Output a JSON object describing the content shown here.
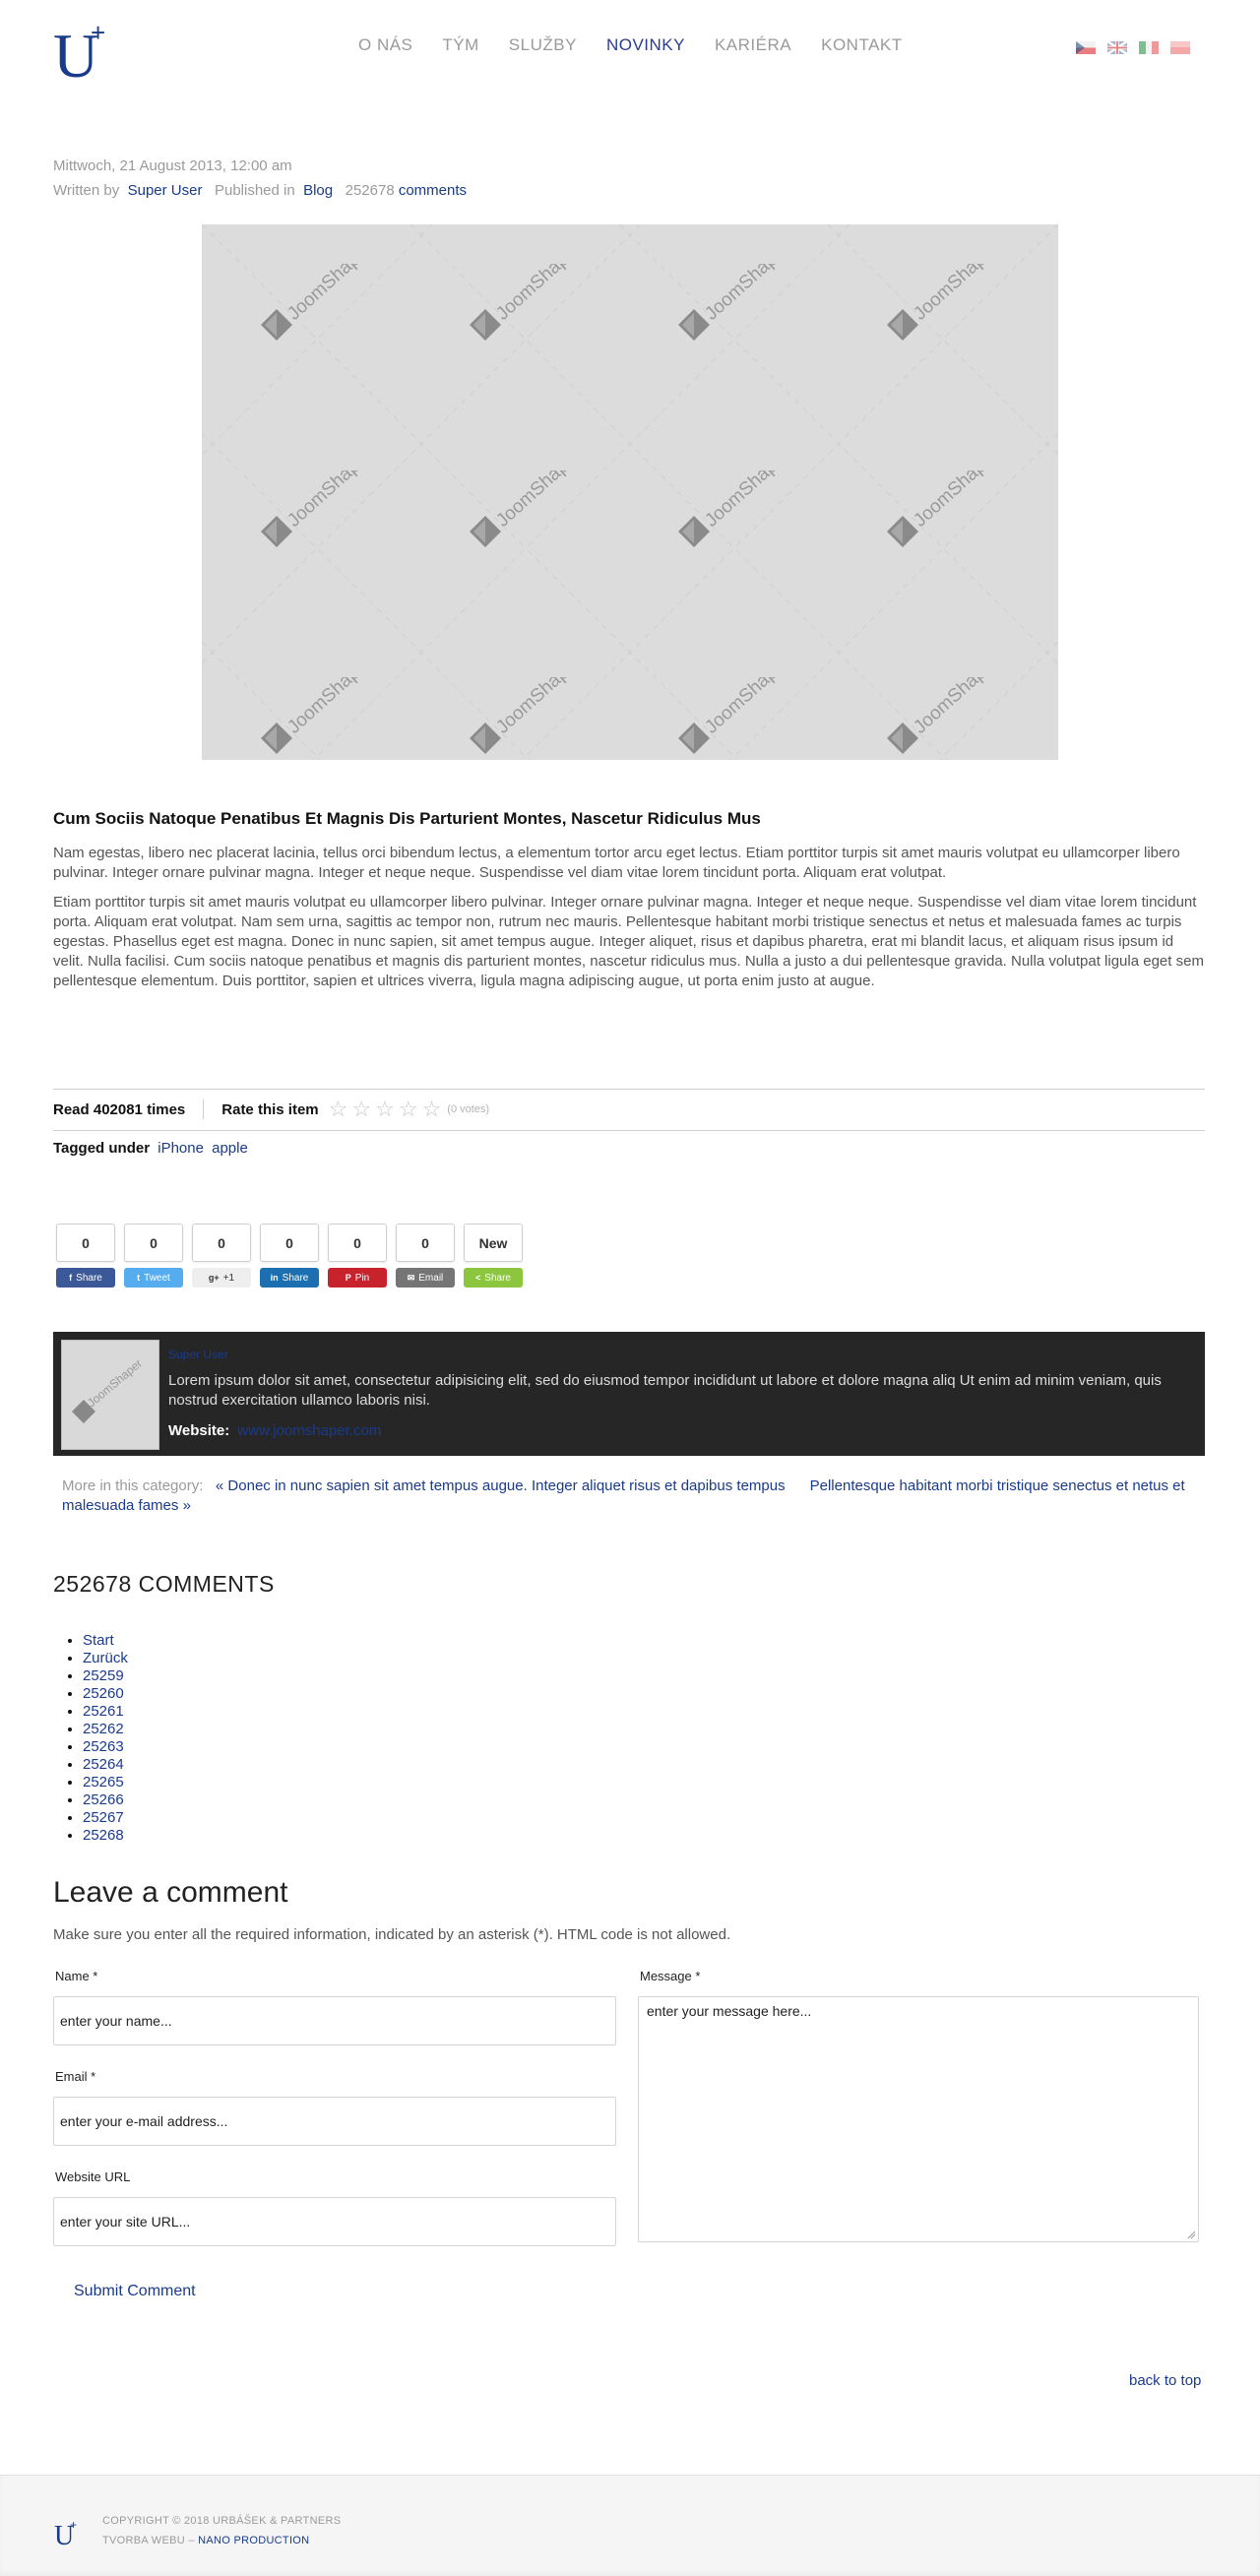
{
  "header": {
    "logo_letter": "U",
    "logo_plus": "+",
    "nav": [
      {
        "label": "O NÁS",
        "active": false
      },
      {
        "label": "TÝM",
        "active": false
      },
      {
        "label": "SLUŽBY",
        "active": false
      },
      {
        "label": "NOVINKY",
        "active": true
      },
      {
        "label": "KARIÉRA",
        "active": false
      },
      {
        "label": "KONTAKT",
        "active": false
      }
    ],
    "flags": [
      "cz-flag-icon",
      "uk-flag-icon",
      "it-flag-icon",
      "pl-flag-icon"
    ]
  },
  "article": {
    "date": "Mittwoch, 21 August 2013, 12:00 am",
    "written_by_label": "Written by",
    "author": "Super User",
    "published_in_label": "Published in",
    "category": "Blog",
    "comment_count": "252678",
    "comments_link": "comments",
    "image_watermark": "JoomShaper",
    "title": "Cum Sociis Natoque Penatibus Et Magnis Dis Parturient Montes, Nascetur Ridiculus Mus",
    "paragraph1": "Nam egestas, libero nec placerat lacinia, tellus orci bibendum lectus, a elementum tortor arcu eget lectus. Etiam porttitor turpis sit amet mauris volutpat eu ullamcorper libero pulvinar. Integer ornare pulvinar magna. Integer et neque neque. Suspendisse vel diam vitae lorem tincidunt porta. Aliquam erat volutpat.",
    "paragraph2": "Etiam porttitor turpis sit amet mauris volutpat eu ullamcorper libero pulvinar. Integer ornare pulvinar magna. Integer et neque neque. Suspendisse vel diam vitae lorem tincidunt porta. Aliquam erat volutpat. Nam sem urna, sagittis ac tempor non, rutrum nec mauris. Pellentesque habitant morbi tristique senectus et netus et malesuada fames ac turpis egestas. Phasellus eget est magna. Donec in nunc sapien, sit amet tempus augue. Integer aliquet, risus et dapibus pharetra, erat mi blandit lacus, et aliquam risus ipsum id velit. Nulla facilisi. Cum sociis natoque penatibus et magnis dis parturient montes, nascetur ridiculus mus. Nulla a justo a dui pellentesque gravida. Nulla volutpat ligula eget sem pellentesque elementum. Duis porttitor, sapien et ultrices viverra, ligula magna adipiscing augue, ut porta enim justo at augue."
  },
  "stats": {
    "read_label": "Read 402081 times",
    "rate_label": "Rate this item",
    "rating": 0,
    "stars_max": 5,
    "votes_text": "(0 votes)"
  },
  "tags": {
    "label": "Tagged under",
    "items": [
      "iPhone",
      "apple"
    ]
  },
  "share": [
    {
      "count": "0",
      "label": "Share",
      "icon": "facebook-icon",
      "glyph": "f",
      "color": "#3b5998",
      "text_color": "#ffffff"
    },
    {
      "count": "0",
      "label": "Tweet",
      "icon": "twitter-icon",
      "glyph": "t",
      "color": "#55acee",
      "text_color": "#ffffff"
    },
    {
      "count": "0",
      "label": "+1",
      "icon": "google-plus-icon",
      "glyph": "g+",
      "color": "#eeeeee",
      "text_color": "#333333"
    },
    {
      "count": "0",
      "label": "Share",
      "icon": "linkedin-icon",
      "glyph": "in",
      "color": "#1c6fb0",
      "text_color": "#ffffff"
    },
    {
      "count": "0",
      "label": "Pin",
      "icon": "pinterest-icon",
      "glyph": "P",
      "color": "#c8232c",
      "text_color": "#ffffff"
    },
    {
      "count": "0",
      "label": "Email",
      "icon": "email-icon",
      "glyph": "✉",
      "color": "#757575",
      "text_color": "#ffffff"
    },
    {
      "count": "New",
      "label": "Share",
      "icon": "share-icon",
      "glyph": "<",
      "color": "#8cc63f",
      "text_color": "#ffffff"
    }
  ],
  "author_box": {
    "name": "Super User",
    "bio": "Lorem ipsum dolor sit amet, consectetur adipisicing elit, sed do eiusmod tempor incididunt ut labore et dolore magna aliq Ut enim ad minim veniam, quis nostrud exercitation ullamco laboris nisi.",
    "website_label": "Website:",
    "website": "www.joomshaper.com"
  },
  "more_in_category": {
    "label": "More in this category:",
    "prev": "« Donec in nunc sapien sit amet tempus augue. Integer aliquet risus et dapibus tempus",
    "next": "Pellentesque habitant morbi tristique senectus et netus et malesuada fames »"
  },
  "comments": {
    "heading": "252678 COMMENTS",
    "pagination": [
      "Start",
      "Zurück",
      "25259",
      "25260",
      "25261",
      "25262",
      "25263",
      "25264",
      "25265",
      "25266",
      "25267",
      "25268"
    ]
  },
  "form": {
    "heading": "Leave a comment",
    "note": "Make sure you enter all the required information, indicated by an asterisk (*). HTML code is not allowed.",
    "name_label": "Name *",
    "name_placeholder": "enter your name...",
    "email_label": "Email *",
    "email_placeholder": "enter your e-mail address...",
    "url_label": "Website URL",
    "url_placeholder": "enter your site URL...",
    "message_label": "Message *",
    "message_placeholder": "enter your message here...",
    "submit": "Submit Comment"
  },
  "back_to_top": "back to top",
  "footer": {
    "copyright": "COPYRIGHT © 2018 URBÁŠEK & PARTNERS",
    "credit_prefix": "TVORBA WEBU –",
    "credit_link": "NANO PRODUCTION"
  },
  "colors": {
    "accent": "#1a3a8c",
    "author_box_bg": "#262626"
  }
}
